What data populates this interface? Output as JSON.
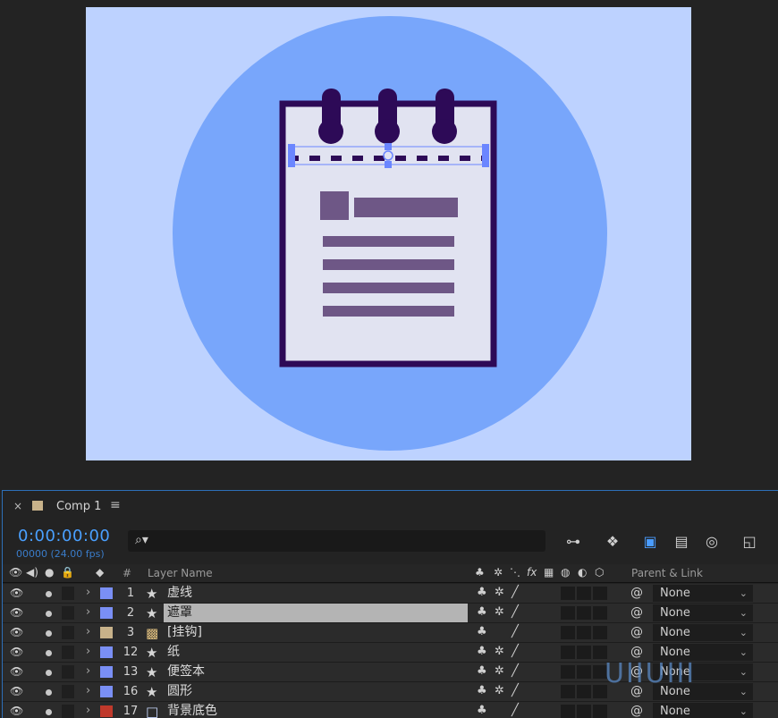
{
  "colors": {
    "canvas_bg": "#bdd2ff",
    "circle": "#78a6fb",
    "notebook_border": "#2d0a57",
    "paper": "#e1e3f1",
    "text_bars": "#6e5786",
    "ring": "#2d0a57",
    "accent_blue": "#4aa0ff",
    "selected_row": "#b4b4b4"
  },
  "panel": {
    "close_icon": "×",
    "tab_label": "Comp 1",
    "menu_icon": "≡"
  },
  "timeline": {
    "timecode": "0:00:00:00",
    "frame_info": "00000 (24.00 fps)",
    "search_placeholder": ""
  },
  "columns": {
    "number_header": "#",
    "layer_name_header": "Layer Name",
    "parent_header": "Parent & Link"
  },
  "layers": [
    {
      "number": "1",
      "name": "虚线",
      "type": "shape",
      "label_color": "#7a8ff5",
      "selected": false,
      "parent": "None"
    },
    {
      "number": "2",
      "name": "遮罩",
      "type": "shape",
      "label_color": "#7a8ff5",
      "selected": true,
      "parent": "None"
    },
    {
      "number": "3",
      "name": "[挂钩]",
      "type": "precomp",
      "label_color": "#c8b28a",
      "selected": false,
      "parent": "None"
    },
    {
      "number": "12",
      "name": "纸",
      "type": "shape",
      "label_color": "#7a8ff5",
      "selected": false,
      "parent": "None"
    },
    {
      "number": "13",
      "name": "便签本",
      "type": "shape",
      "label_color": "#7a8ff5",
      "selected": false,
      "parent": "None"
    },
    {
      "number": "16",
      "name": "圆形",
      "type": "shape",
      "label_color": "#7a8ff5",
      "selected": false,
      "parent": "None"
    },
    {
      "number": "17",
      "name": "背景底色",
      "type": "solid",
      "label_color": "#c0392b",
      "selected": false,
      "parent": "None"
    }
  ],
  "watermark": {
    "text": "UIIUIII"
  }
}
